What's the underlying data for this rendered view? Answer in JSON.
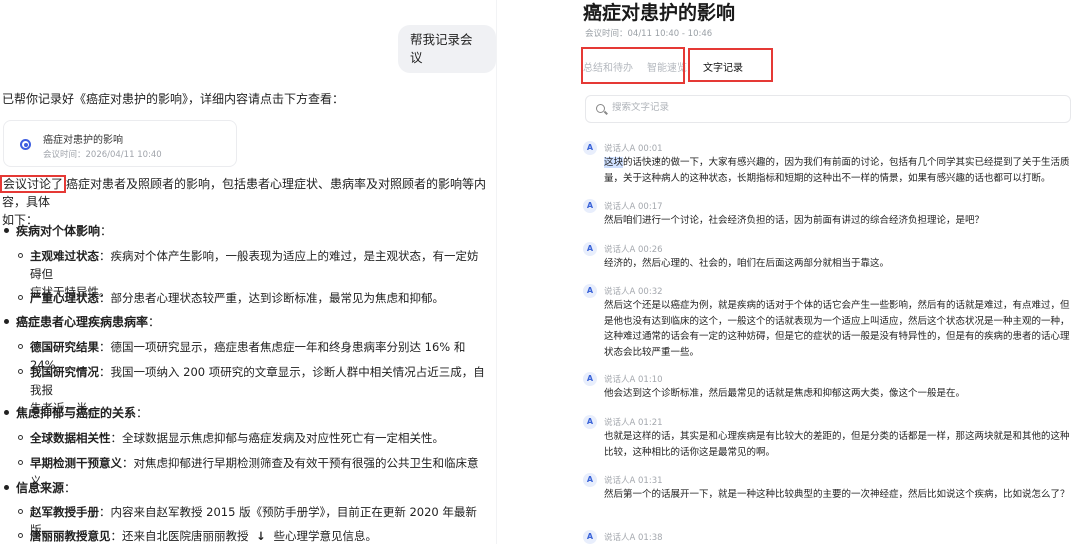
{
  "left": {
    "user_message": "帮我记录会议",
    "intro": "已帮你记录好《癌症对患护的影响》，详细内容请点击下方查看：",
    "card": {
      "title": "癌症对患护的影响",
      "subtitle": "会议时间：2026/04/11 10:40"
    },
    "summary_highlight": "会议讨论了",
    "summary_rest_1": "癌症对患者及照顾者的影响，包括患者心理症状、患病率及对照顾者的影响等内容，具体",
    "summary_rest_2": "如下：",
    "sections": [
      {
        "title": "疾病对个体影响",
        "colon": "：",
        "items": [
          {
            "label": "主观难过状态",
            "text": "：疾病对个体产生影响，一般表现为适应上的难过，是主观状态，有一定妨碍但",
            "text2": "症状无特异性。"
          },
          {
            "label": "严重心理状态",
            "text": "：部分患者心理状态较严重，达到诊断标准，最常见为焦虑和抑郁。"
          }
        ]
      },
      {
        "title": "癌症患者心理疾病患病率",
        "colon": "：",
        "items": [
          {
            "label": "德国研究结果",
            "text": "：德国一项研究显示，癌症患者焦虑症一年和终身患病率分别达 16% 和 24%。"
          },
          {
            "label": "我国研究情况",
            "text": "：我国一项纳入 200 项研究的文章显示，诊断人群中相关情况占近三成，自我报",
            "text2": "告者近一半。"
          }
        ]
      },
      {
        "title": "焦虑抑郁与癌症的关系",
        "colon": "：",
        "items": [
          {
            "label": "全球数据相关性",
            "text": "：全球数据显示焦虑抑郁与癌症发病及对应性死亡有一定相关性。"
          },
          {
            "label": "早期检测干预意义",
            "text": "：对焦虑抑郁进行早期检测筛查及有效干预有很强的公共卫生和临床意义。"
          }
        ]
      },
      {
        "title": "信息来源",
        "colon": "：",
        "items": [
          {
            "label": "赵军教授手册",
            "text": "：内容来自赵军教授 2015 版《预防手册学》，目前正在更新 2020 年最新版。"
          },
          {
            "label": "唐丽丽教授意见",
            "text": "：还来自北医院唐丽丽教授",
            "text_after": "些心理学意见信息。"
          }
        ]
      }
    ]
  },
  "right": {
    "title": "癌症对患护的影响",
    "time": "会议时间：04/11 10:40 - 10:46",
    "tabs": [
      "总结和待办",
      "智能速览",
      "文字记录"
    ],
    "search_placeholder": "搜索文字记录",
    "entries": [
      {
        "avatar": "A",
        "speaker": "说话人A  00:01",
        "sel": "这块",
        "text": "的话快速的做一下，大家有感兴趣的，因为我们有前面的讨论，包括有几个同学其实已经提到了关于生活质量，关于这种病人的这种状态，长期指标和短期的这种出不一样的情景，如果有感兴趣的话也都可以打断。"
      },
      {
        "avatar": "A",
        "speaker": "说话人A  00:17",
        "text": "然后咱们进行一个讨论，社会经济负担的话，因为前面有讲过的综合经济负担理论，是吧？"
      },
      {
        "avatar": "A",
        "speaker": "说话人A  00:26",
        "text": "经济的，然后心理的、社会的，咱们在后面这两部分就相当于靠这。"
      },
      {
        "avatar": "A",
        "speaker": "说话人A  00:32",
        "text": "然后这个还是以癌症为例，就是疾病的话对于个体的话它会产生一些影响，然后有的话就是难过，有点难过，但是他也没有达到临床的这个，一般这个的话就表现为一个适应上叫适应，然后这个状态状况是一种主观的一种，这种难过通常的话会有一定的这种妨碍，但是它的症状的话一般是没有特异性的，但是有的疾病的患者的话心理状态会比较严重一些。"
      },
      {
        "avatar": "A",
        "speaker": "说话人A  01:10",
        "text": "他会达到这个诊断标准，然后最常见的话就是焦虑和抑郁这两大类，像这个一般是在。"
      },
      {
        "avatar": "A",
        "speaker": "说话人A  01:21",
        "text": "也就是这样的话，其实是和心理疾病是有比较大的差距的，但是分类的话都是一样，那这两块就是和其他的这种比较，这种相比的话你这是最常见的啊。"
      },
      {
        "avatar": "A",
        "speaker": "说话人A  01:31",
        "text": "然后第一个的话展开一下，就是一种这种比较典型的主要的一次神经症，然后比如说这个疾病，比如说怎么了？"
      },
      {
        "avatar": "A",
        "speaker": "说话人A  01:38",
        "text": ""
      }
    ]
  },
  "colors": {
    "accent": "#3f5fe0",
    "highlight_box": "#e53935",
    "selection": "#cfe0ff"
  },
  "icons": {
    "search": "search-icon",
    "down_arrow": "arrow-down-icon",
    "doc_selected": "radio-selected-icon"
  }
}
